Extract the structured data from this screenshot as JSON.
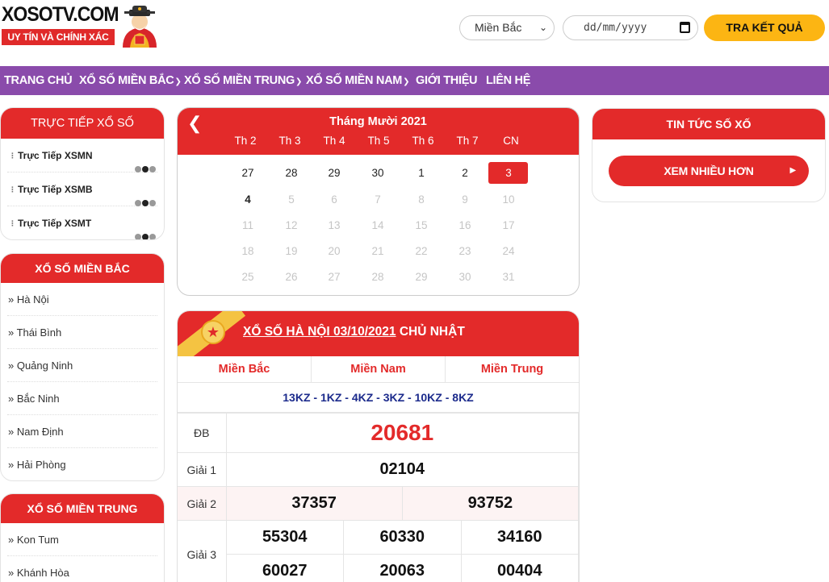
{
  "brand": {
    "name": "XOSOTV.COM",
    "tagline": "UY TÍN VÀ CHÍNH XÁC",
    "accent": "#e32a2a",
    "nav_color": "#8a4bab",
    "button_color": "#fcb513"
  },
  "search": {
    "region": "Miền Bắc",
    "date_placeholder": "dd/mm/yyyy",
    "submit": "TRA KẾT QUẢ"
  },
  "nav": {
    "items": [
      "TRANG CHỦ",
      "XỔ SỐ MIỀN BẮC",
      "XỔ SỐ MIỀN TRUNG",
      "XỔ SỐ MIỀN NAM",
      "GIỚI THIỆU",
      "LIÊN HỆ"
    ]
  },
  "live": {
    "title": "TRỰC TIẾP XỔ SỐ",
    "items": [
      "Trực Tiếp XSMN",
      "Trực Tiếp XSMB",
      "Trực Tiếp XSMT"
    ]
  },
  "north": {
    "title": "XỔ SỐ MIỀN BẮC",
    "items": [
      "» Hà Nội",
      "» Thái Bình",
      "» Quảng Ninh",
      "» Bắc Ninh",
      "» Nam Định",
      "» Hải Phòng"
    ]
  },
  "central": {
    "title": "XỔ SỐ MIỀN TRUNG",
    "items": [
      "» Kon Tum",
      "» Khánh Hòa"
    ]
  },
  "calendar": {
    "title": "Tháng Mười 2021",
    "weekdays": [
      "Th 2",
      "Th 3",
      "Th 4",
      "Th 5",
      "Th 6",
      "Th 7",
      "CN"
    ],
    "weeks": [
      [
        "27",
        "28",
        "29",
        "30",
        "1",
        "2",
        "3"
      ],
      [
        "4",
        "5",
        "6",
        "7",
        "8",
        "9",
        "10"
      ],
      [
        "11",
        "12",
        "13",
        "14",
        "15",
        "16",
        "17"
      ],
      [
        "18",
        "19",
        "20",
        "21",
        "22",
        "23",
        "24"
      ],
      [
        "25",
        "26",
        "27",
        "28",
        "29",
        "30",
        "31"
      ]
    ]
  },
  "results": {
    "title_link": "XỔ SỐ HÀ NỘI 03/10/2021",
    "title_day": " CHỦ NHẬT",
    "tabs": [
      "Miền Bắc",
      "Miền Nam",
      "Miền Trung"
    ],
    "codes": "13KZ - 1KZ - 4KZ - 3KZ - 10KZ - 8KZ",
    "special_label": "ĐB",
    "special": "20681",
    "g1_label": "Giải 1",
    "g1": "02104",
    "g2_label": "Giải 2",
    "g2": [
      "37357",
      "93752"
    ],
    "g3_label": "Giải 3",
    "g3": [
      "55304",
      "60330",
      "34160",
      "60027",
      "20063",
      "00404"
    ]
  },
  "news": {
    "title": "TIN TỨC SỐ XỐ",
    "more": "XEM NHIỀU HƠN"
  }
}
